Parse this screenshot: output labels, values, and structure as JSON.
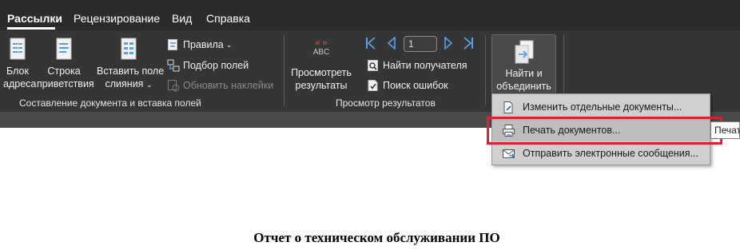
{
  "tabs": [
    {
      "label": "Рассылки",
      "active": true
    },
    {
      "label": "Рецензирование",
      "active": false
    },
    {
      "label": "Вид",
      "active": false
    },
    {
      "label": "Справка",
      "active": false
    }
  ],
  "ribbon": {
    "group_compose": {
      "label": "Составление документа и вставка полей",
      "address_block": {
        "line1": "Блок",
        "line2": "адреса",
        "icon": "address-block-icon"
      },
      "greeting_line": {
        "line1": "Строка",
        "line2": "приветствия",
        "icon": "greeting-line-icon"
      },
      "insert_merge_field": {
        "line1": "Вставить поле",
        "line2": "слияния",
        "icon": "insert-merge-field-icon"
      },
      "rules": {
        "label": "Правила",
        "icon": "rules-icon"
      },
      "match_fields": {
        "label": "Подбор полей",
        "icon": "match-fields-icon"
      },
      "update_labels": {
        "label": "Обновить наклейки",
        "icon": "update-labels-icon",
        "disabled": true
      }
    },
    "group_preview": {
      "label": "Просмотр результатов",
      "preview_results": {
        "line1": "Просмотреть",
        "line2": "результаты",
        "icon_text": "« »",
        "icon_caption": "ABC"
      },
      "record_number": "1",
      "find_recipient": {
        "label": "Найти получателя",
        "icon": "find-recipient-icon"
      },
      "check_errors": {
        "label": "Поиск ошибок",
        "icon": "check-errors-icon"
      }
    },
    "group_finish": {
      "finish_merge": {
        "line1": "Найти и",
        "line2": "объединить",
        "icon": "finish-merge-icon"
      }
    }
  },
  "dropdown": {
    "items": [
      {
        "label": "Изменить отдельные документы...",
        "icon": "edit-documents-icon"
      },
      {
        "label": "Печать документов...",
        "icon": "print-documents-icon"
      },
      {
        "label": "Отправить электронные сообщения...",
        "icon": "send-email-icon"
      }
    ],
    "tooltip": "Печати"
  },
  "document": {
    "title": "Отчет о техническом обслуживании ПО"
  },
  "colors": {
    "tab_bar": "#2b2b2b",
    "ribbon": "#353535",
    "dropdown": "#cfcfcf",
    "highlight": "#e0212b",
    "accent_blue": "#5aa0e6"
  }
}
